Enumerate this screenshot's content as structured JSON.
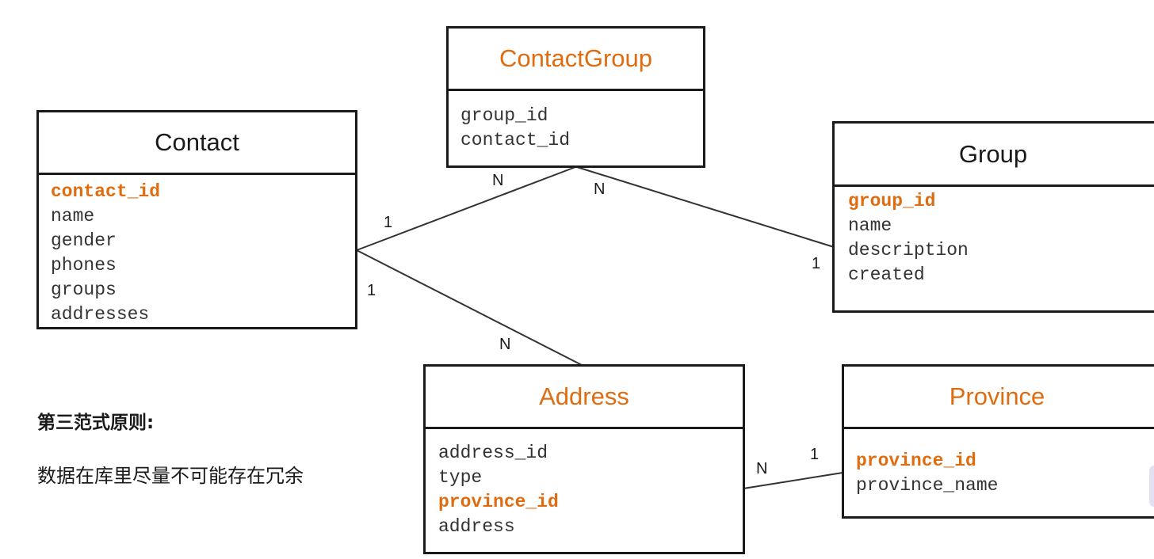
{
  "entities": {
    "contact": {
      "title": "Contact",
      "fields": [
        "contact_id",
        "name",
        "gender",
        "phones",
        "groups",
        "addresses"
      ]
    },
    "contact_group": {
      "title": "ContactGroup",
      "fields": [
        "group_id",
        "contact_id"
      ]
    },
    "group": {
      "title": "Group",
      "fields": [
        "group_id",
        "name",
        "description",
        "created"
      ]
    },
    "address": {
      "title": "Address",
      "fields": [
        "address_id",
        "type",
        "province_id",
        "address"
      ]
    },
    "province": {
      "title": "Province",
      "fields": [
        "province_id",
        "province_name"
      ]
    }
  },
  "relationships": {
    "contact_to_contactgroup": {
      "from_card": "1",
      "to_card": "N"
    },
    "group_to_contactgroup": {
      "from_card": "1",
      "to_card": "N"
    },
    "contact_to_address": {
      "from_card": "1",
      "to_card": "N"
    },
    "province_to_address": {
      "from_card": "1",
      "to_card": "N"
    }
  },
  "note": {
    "title": "第三范式原则:",
    "body": "数据在库里尽量不可能存在冗余"
  },
  "colors": {
    "accent": "#e06c10",
    "border": "#1a1a1a",
    "text": "#333333"
  }
}
